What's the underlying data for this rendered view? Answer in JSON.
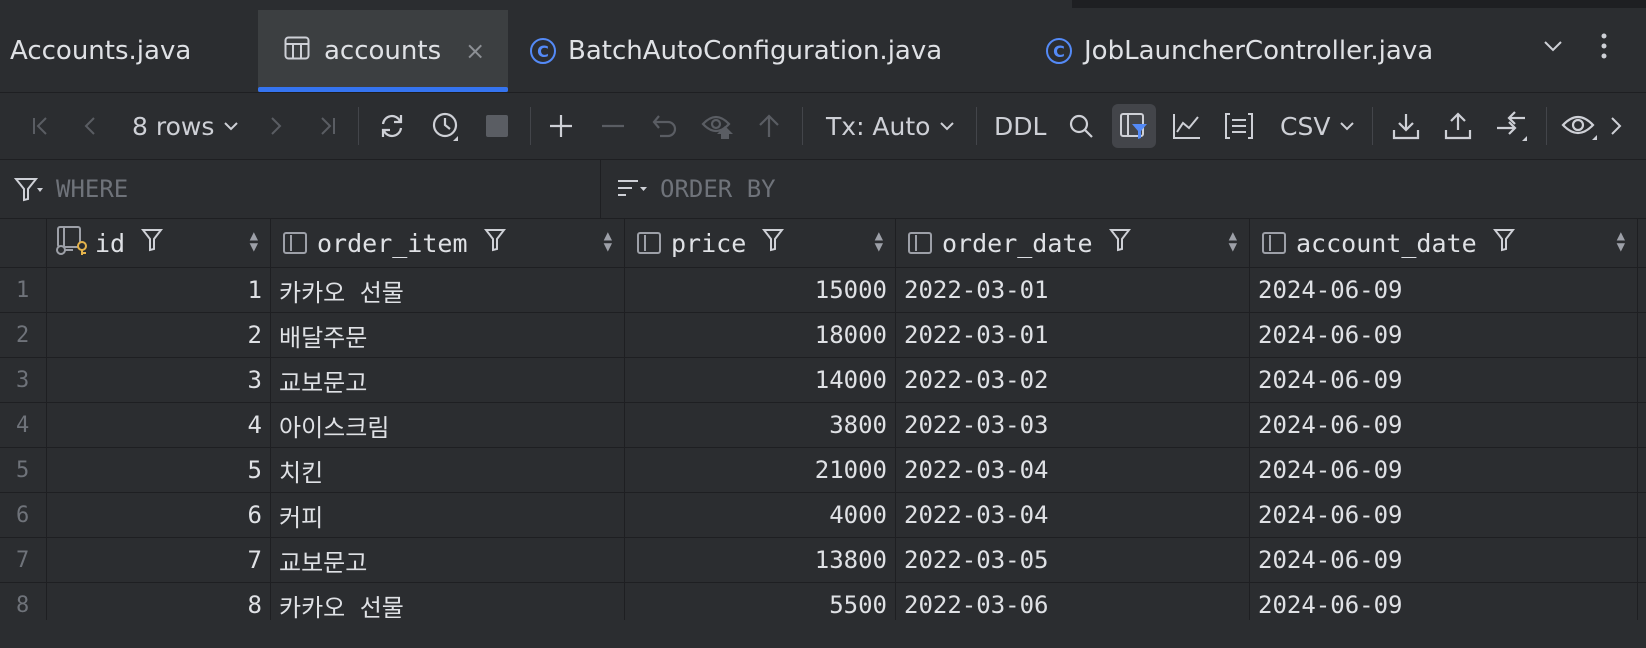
{
  "tabs": [
    {
      "label": "Accounts.java",
      "active": false,
      "icon": "none"
    },
    {
      "label": "accounts",
      "active": true,
      "icon": "table-icon"
    },
    {
      "label": "BatchAutoConfiguration.java",
      "active": false,
      "icon": "class-icon"
    },
    {
      "label": "JobLauncherController.java",
      "active": false,
      "icon": "class-icon"
    }
  ],
  "class_icon_glyph": "C",
  "close_glyph": "×",
  "toolbar": {
    "rows_label": "8 rows",
    "tx_label": "Tx: Auto",
    "ddl_label": "DDL",
    "csv_label": "CSV"
  },
  "filter": {
    "where_placeholder": "WHERE",
    "order_placeholder": "ORDER BY"
  },
  "columns": [
    "id",
    "order_item",
    "price",
    "order_date",
    "account_date"
  ],
  "rows": [
    {
      "n": "1",
      "id": "1",
      "order_item": "카카오 선물",
      "price": "15000",
      "order_date": "2022-03-01",
      "account_date": "2024-06-09"
    },
    {
      "n": "2",
      "id": "2",
      "order_item": "배달주문",
      "price": "18000",
      "order_date": "2022-03-01",
      "account_date": "2024-06-09"
    },
    {
      "n": "3",
      "id": "3",
      "order_item": "교보문고",
      "price": "14000",
      "order_date": "2022-03-02",
      "account_date": "2024-06-09"
    },
    {
      "n": "4",
      "id": "4",
      "order_item": "아이스크림",
      "price": "3800",
      "order_date": "2022-03-03",
      "account_date": "2024-06-09"
    },
    {
      "n": "5",
      "id": "5",
      "order_item": "치킨",
      "price": "21000",
      "order_date": "2022-03-04",
      "account_date": "2024-06-09"
    },
    {
      "n": "6",
      "id": "6",
      "order_item": "커피",
      "price": "4000",
      "order_date": "2022-03-04",
      "account_date": "2024-06-09"
    },
    {
      "n": "7",
      "id": "7",
      "order_item": "교보문고",
      "price": "13800",
      "order_date": "2022-03-05",
      "account_date": "2024-06-09"
    },
    {
      "n": "8",
      "id": "8",
      "order_item": "카카오 선물",
      "price": "5500",
      "order_date": "2022-03-06",
      "account_date": "2024-06-09"
    }
  ],
  "colors": {
    "accent": "#3574f0",
    "class_icon": "#548af7",
    "key_icon": "#e5b34b"
  }
}
